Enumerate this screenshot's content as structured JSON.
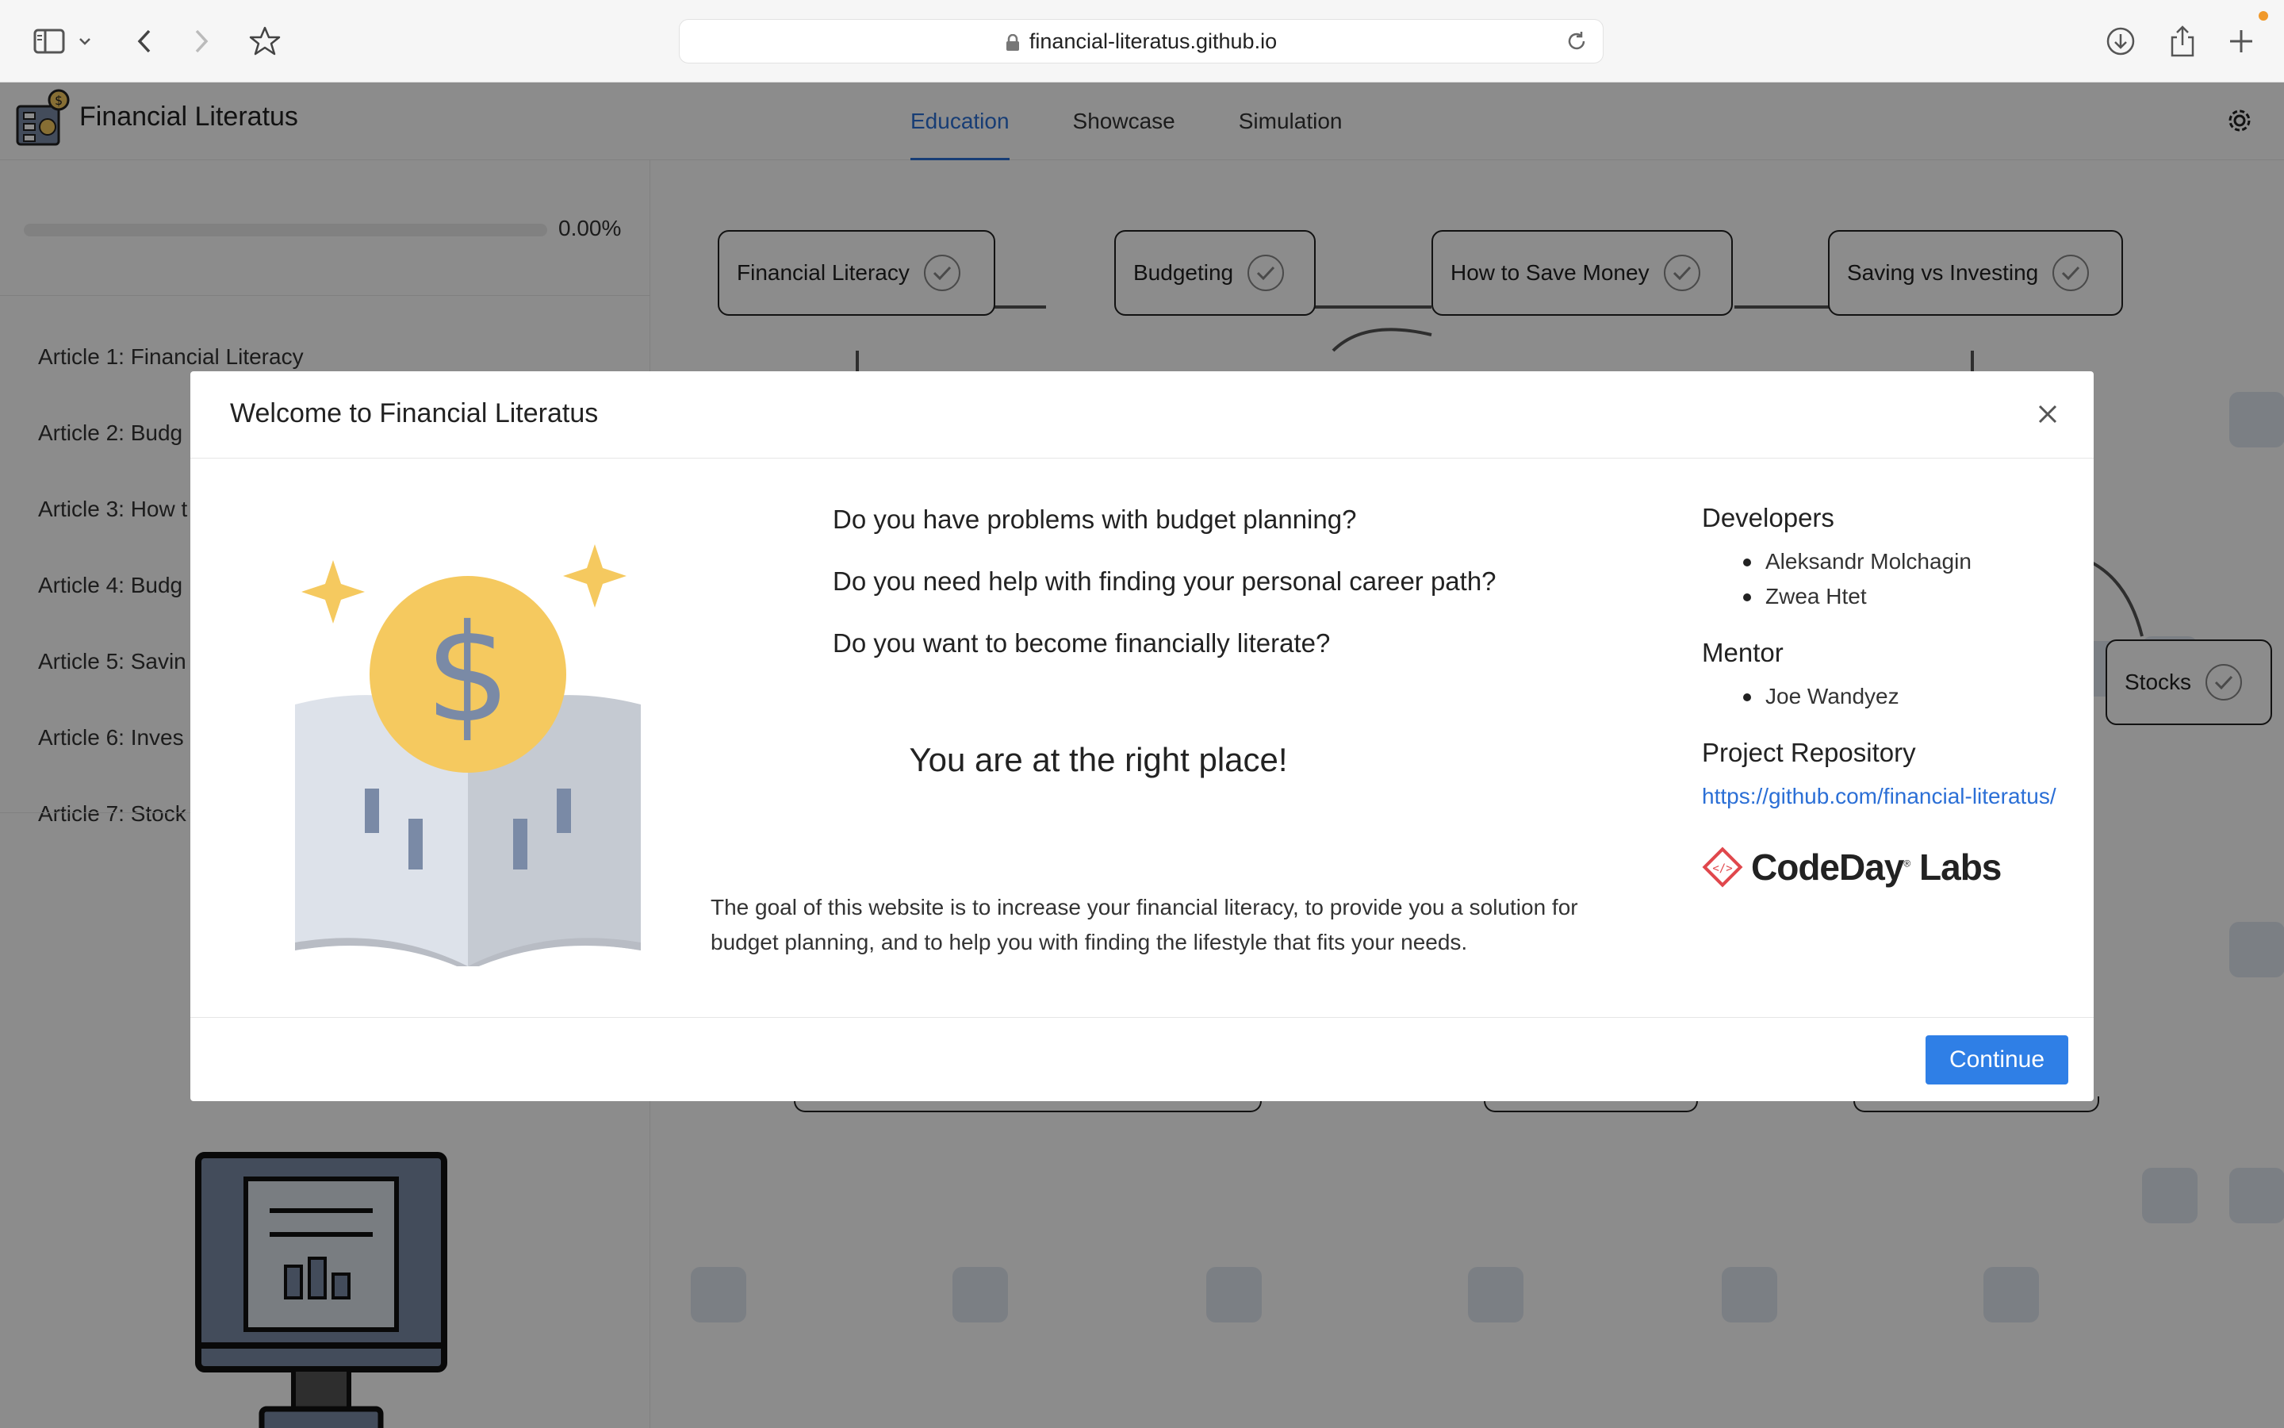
{
  "browser": {
    "url": "financial-literatus.github.io"
  },
  "app": {
    "title": "Financial Literatus",
    "tabs": [
      {
        "label": "Education",
        "active": true
      },
      {
        "label": "Showcase",
        "active": false
      },
      {
        "label": "Simulation",
        "active": false
      }
    ]
  },
  "sidebar": {
    "progress_label": "0.00%",
    "progress_fraction": 0.0,
    "articles": [
      "Article 1: Financial Literacy",
      "Article 2: Budg",
      "Article 3: How t",
      "Article 4: Budg",
      "Article 5: Savin",
      "Article 6: Inves",
      "Article 7: Stock"
    ]
  },
  "map": {
    "nodes": [
      "Financial Literacy",
      "Budgeting",
      "How to Save Money",
      "Saving vs Investing",
      "Stocks"
    ]
  },
  "modal": {
    "title": "Welcome to Financial Literatus",
    "questions": [
      "Do you have problems with budget planning?",
      "Do you need help with finding your personal career path?",
      "Do you want to become financially literate?"
    ],
    "tagline": "You are at the right place!",
    "goal": "The goal of this website is to increase your financial literacy, to provide you a solution for budget planning, and to help you with finding the lifestyle that fits your needs.",
    "developers_heading": "Developers",
    "developers": [
      "Aleksandr Molchagin",
      "Zwea Htet"
    ],
    "mentor_heading": "Mentor",
    "mentors": [
      "Joe Wandyez"
    ],
    "repo_heading": "Project Repository",
    "repo_link": "https://github.com/financial-literatus/",
    "sponsor_name": "CodeDay",
    "sponsor_suffix": "Labs",
    "continue_label": "Continue"
  },
  "colors": {
    "accent": "#2b6fd6",
    "button": "#2f7fe6",
    "coin": "#f5c95f",
    "codeday_red": "#e0474c"
  }
}
